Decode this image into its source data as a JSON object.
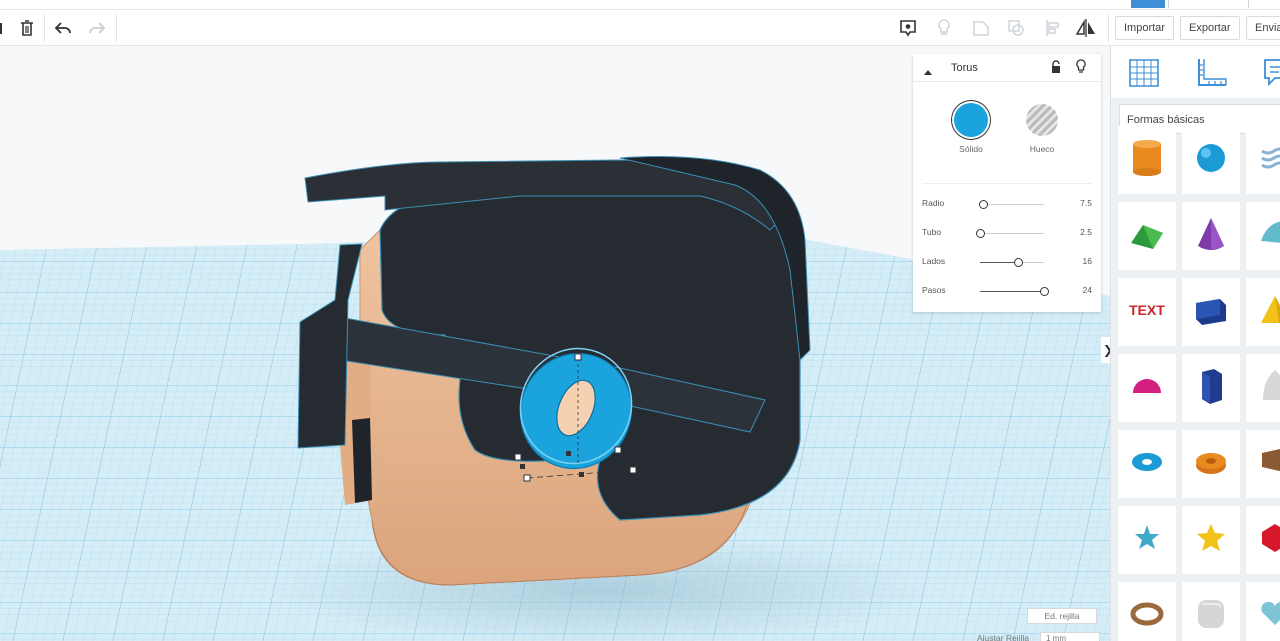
{
  "toolbar": {
    "import_label": "Importar",
    "export_label": "Exportar",
    "send_label": "Enviar"
  },
  "inspector": {
    "title": "Torus",
    "solid_label": "Sólido",
    "hole_label": "Hueco",
    "solid_color": "#1aa3dd",
    "params": [
      {
        "label": "Radio",
        "value": "7.5",
        "fraction": 0.05
      },
      {
        "label": "Tubo",
        "value": "2.5",
        "fraction": 0.0
      },
      {
        "label": "Lados",
        "value": "16",
        "fraction": 0.6
      },
      {
        "label": "Pasos",
        "value": "24",
        "fraction": 1.0
      }
    ]
  },
  "panel": {
    "category": "Formas básicas",
    "shapes": [
      "cylinder-shape-icon",
      "sphere-shape-icon",
      "scribble-shape-icon",
      "roof-shape-icon",
      "cone-shape-icon",
      "round-roof-shape-icon",
      "text-shape-icon",
      "box-shape-icon",
      "pyramid-shape-icon",
      "half-sphere-shape-icon",
      "polygon-shape-icon",
      "paraboloid-shape-icon",
      "torus-shape-icon",
      "tube-shape-icon",
      "wedge-shape-icon",
      "star-shape-icon",
      "star-alt-shape-icon",
      "icosahedron-shape-icon",
      "ring-shape-icon",
      "dice-shape-icon",
      "heart-shape-icon"
    ]
  },
  "grid": {
    "edit_label": "Ed. rejilla",
    "snap_label": "Ajustar Rejilla",
    "snap_value": "1 mm"
  },
  "colors": {
    "grid_blue": "#bfe3f2",
    "head_skin": "#e8b892",
    "hair_dark": "#262b31",
    "torus_blue": "#1aa3dd",
    "accent_blue": "#3d8fd6"
  }
}
